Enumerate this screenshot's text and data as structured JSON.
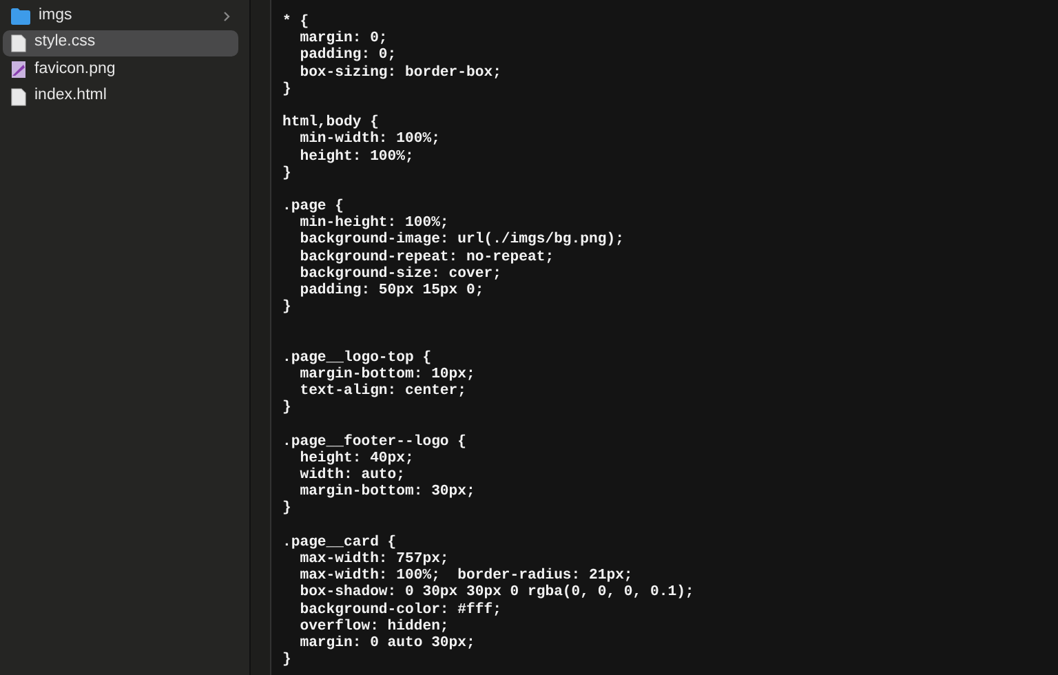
{
  "sidebar": {
    "items": [
      {
        "name": "imgs",
        "kind": "folder",
        "selected": false,
        "expandable": true
      },
      {
        "name": "style.css",
        "kind": "file",
        "selected": true,
        "expandable": false
      },
      {
        "name": "favicon.png",
        "kind": "image",
        "selected": false,
        "expandable": false
      },
      {
        "name": "index.html",
        "kind": "file",
        "selected": false,
        "expandable": false
      }
    ]
  },
  "editor": {
    "lines": [
      {
        "kind": "code",
        "text": "* {"
      },
      {
        "kind": "code",
        "text": "  margin: 0;"
      },
      {
        "kind": "code",
        "text": "  padding: 0;"
      },
      {
        "kind": "code",
        "text": "  box-sizing: border-box;"
      },
      {
        "kind": "code",
        "text": "}"
      },
      {
        "kind": "blank"
      },
      {
        "kind": "code",
        "text": "html,body {"
      },
      {
        "kind": "code",
        "text": "  min-width: 100%;"
      },
      {
        "kind": "code",
        "text": "  height: 100%;"
      },
      {
        "kind": "code",
        "text": "}"
      },
      {
        "kind": "blank"
      },
      {
        "kind": "code",
        "text": ".page {"
      },
      {
        "kind": "code",
        "text": "  min-height: 100%;"
      },
      {
        "kind": "code",
        "text": "  background-image: url(./imgs/bg.png);"
      },
      {
        "kind": "code",
        "text": "  background-repeat: no-repeat;"
      },
      {
        "kind": "code",
        "text": "  background-size: cover;"
      },
      {
        "kind": "code",
        "text": "  padding: 50px 15px 0;"
      },
      {
        "kind": "code",
        "text": "}"
      },
      {
        "kind": "blank"
      },
      {
        "kind": "blank"
      },
      {
        "kind": "code",
        "text": ".page__logo-top {"
      },
      {
        "kind": "code",
        "text": "  margin-bottom: 10px;"
      },
      {
        "kind": "code",
        "text": "  text-align: center;"
      },
      {
        "kind": "code",
        "text": "}"
      },
      {
        "kind": "blank"
      },
      {
        "kind": "code",
        "text": ".page__footer--logo {"
      },
      {
        "kind": "code",
        "text": "  height: 40px;"
      },
      {
        "kind": "code",
        "text": "  width: auto;"
      },
      {
        "kind": "code",
        "text": "  margin-bottom: 30px;"
      },
      {
        "kind": "code",
        "text": "}"
      },
      {
        "kind": "blank"
      },
      {
        "kind": "code",
        "text": ".page__card {"
      },
      {
        "kind": "code",
        "text": "  max-width: 757px;"
      },
      {
        "kind": "code",
        "text": "  max-width: 100%;  border-radius: 21px;"
      },
      {
        "kind": "code",
        "text": "  box-shadow: 0 30px 30px 0 rgba(0, 0, 0, 0.1);"
      },
      {
        "kind": "code",
        "text": "  background-color: #fff;"
      },
      {
        "kind": "code",
        "text": "  overflow: hidden;"
      },
      {
        "kind": "code",
        "text": "  margin: 0 auto 30px;"
      },
      {
        "kind": "code",
        "text": "}"
      }
    ]
  }
}
